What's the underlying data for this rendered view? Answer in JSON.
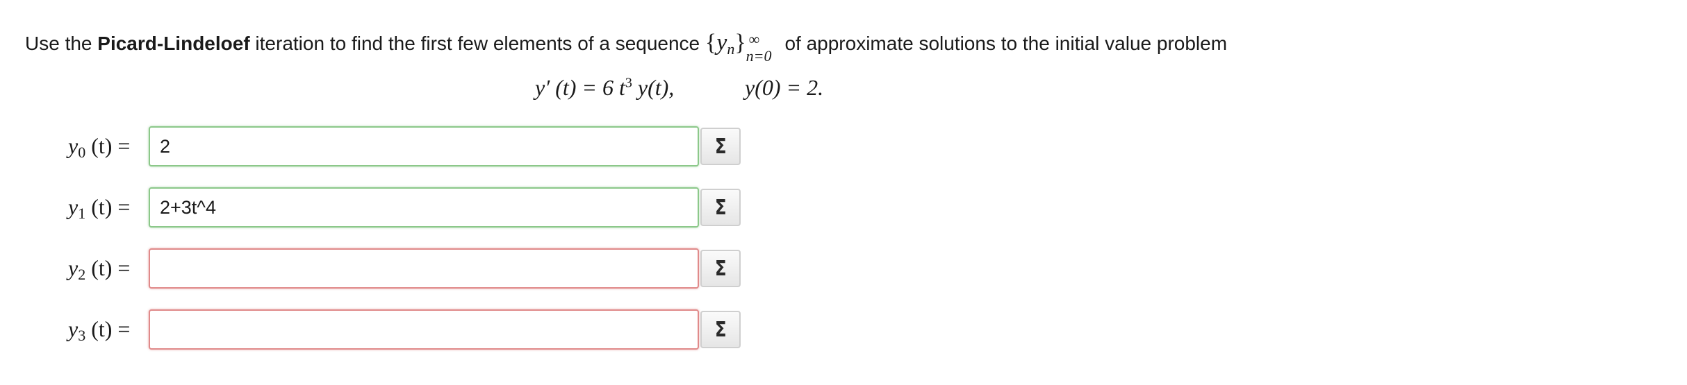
{
  "problem": {
    "intro": "Use the ",
    "method": "Picard-Lindeloef",
    "middle": " iteration to find the first few elements of a sequence ",
    "seq_open": "{",
    "seq_var": "y",
    "seq_var_sub": "n",
    "seq_close": "}",
    "seq_sup": "∞",
    "seq_sub": "n=0",
    "outro": " of approximate solutions to the initial value problem"
  },
  "equation": {
    "lhs": "y′ (t) = 6 t",
    "power": "3",
    "rhs": " y(t),",
    "initial": "y(0) = 2."
  },
  "rows": [
    {
      "var": "y",
      "index": "0",
      "arg": "(t) =",
      "value": "2",
      "status": "correct"
    },
    {
      "var": "y",
      "index": "1",
      "arg": "(t) =",
      "value": "2+3t^4",
      "status": "correct"
    },
    {
      "var": "y",
      "index": "2",
      "arg": "(t) =",
      "value": "",
      "status": "incorrect"
    },
    {
      "var": "y",
      "index": "3",
      "arg": "(t) =",
      "value": "",
      "status": "incorrect"
    }
  ],
  "equation_editor": {
    "icon": "sigma-icon",
    "glyph": "Σ"
  },
  "colors": {
    "correct_border": "#8cc88a",
    "incorrect_border": "#e08a8a"
  }
}
